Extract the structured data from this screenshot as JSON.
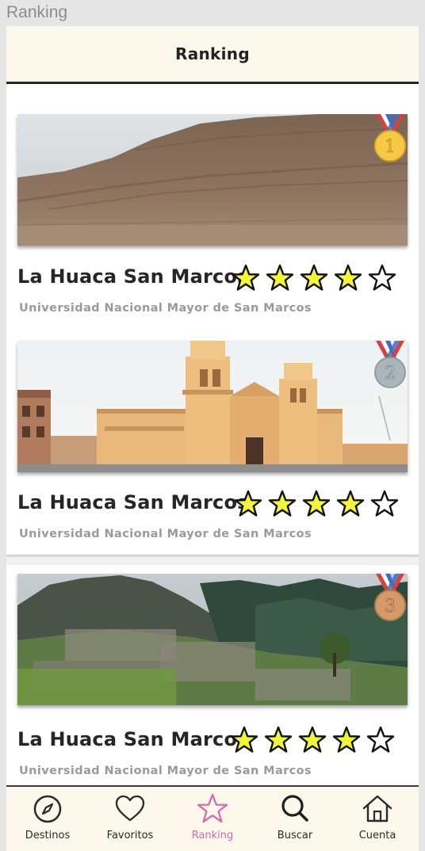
{
  "window": {
    "title": "Ranking"
  },
  "header": {
    "title": "Ranking"
  },
  "colors": {
    "accent": "#d96aa8",
    "star_fill": "#f2f53a",
    "header_bg": "#fdf8ec",
    "medal_gold": "#f7c948",
    "medal_silver": "#a9b7ba",
    "medal_bronze": "#d49a6a"
  },
  "ranking": {
    "items": [
      {
        "rank": "1",
        "title": "La Huaca San Marcos",
        "subtitle": "Universidad Nacional Mayor de San Marcos",
        "rating": 4,
        "max_rating": 5,
        "image": "huaca-ruins",
        "medal": "gold"
      },
      {
        "rank": "2",
        "title": "La Huaca San Marcos",
        "subtitle": "Universidad Nacional Mayor de San Marcos",
        "rating": 4,
        "max_rating": 5,
        "image": "cathedral",
        "medal": "silver"
      },
      {
        "rank": "3",
        "title": "La Huaca San Marcos",
        "subtitle": "Universidad Nacional Mayor de San Marcos",
        "rating": 4,
        "max_rating": 5,
        "image": "machu-picchu",
        "medal": "bronze"
      }
    ]
  },
  "tabbar": {
    "tabs": [
      {
        "label": "Destinos",
        "icon": "compass-icon"
      },
      {
        "label": "Favoritos",
        "icon": "heart-icon"
      },
      {
        "label": "Ranking",
        "icon": "star-icon",
        "active": true
      },
      {
        "label": "Buscar",
        "icon": "search-icon"
      },
      {
        "label": "Cuenta",
        "icon": "home-icon"
      }
    ]
  }
}
